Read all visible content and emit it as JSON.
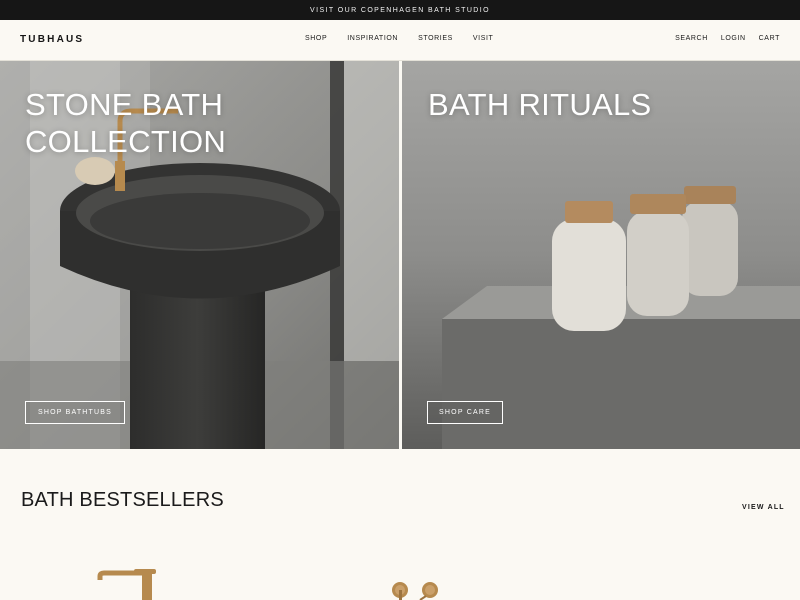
{
  "announcement": "VISIT OUR COPENHAGEN BATH STUDIO",
  "brand": "TUBHAUS",
  "nav": [
    "SHOP",
    "INSPIRATION",
    "STORIES",
    "VISIT"
  ],
  "utility": [
    "SEARCH",
    "LOGIN",
    "CART"
  ],
  "hero": [
    {
      "title": "STONE BATH\nCOLLECTION",
      "button": "SHOP BATHTUBS"
    },
    {
      "title": "BATH RITUALS",
      "button": "SHOP CARE"
    }
  ],
  "bestsellers": {
    "title": "BATH BESTSELLERS",
    "view_all": "VIEW ALL"
  },
  "colors": {
    "announce_bg": "#161616",
    "page_bg": "#fbf9f3",
    "brass": "#b68a4e"
  }
}
